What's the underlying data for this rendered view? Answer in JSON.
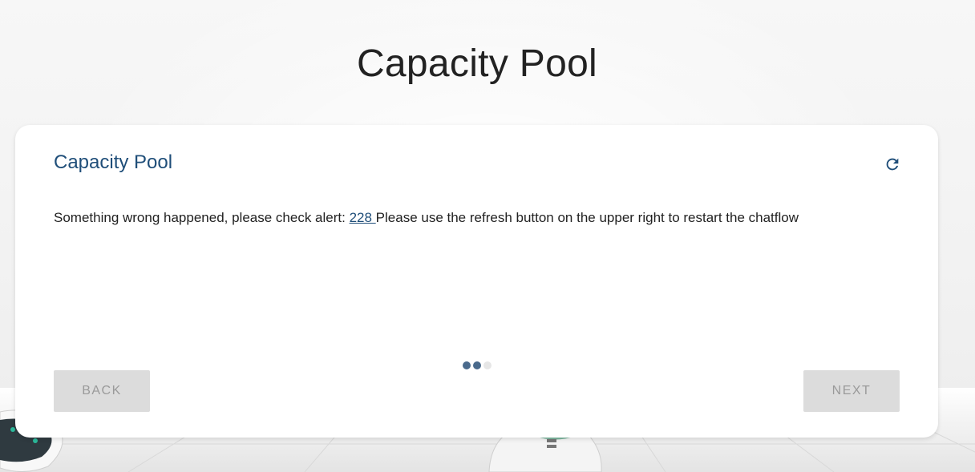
{
  "page": {
    "title": "Capacity Pool"
  },
  "card": {
    "title": "Capacity Pool",
    "refresh_icon": "refresh-icon",
    "message": {
      "prefix": "Something wrong happened, please check alert: ",
      "alert_link": "228 ",
      "suffix": "Please use the refresh button on the upper right to restart the chatflow"
    },
    "stepper": {
      "total_steps": 3,
      "current_step": 2
    },
    "back_label": "Back",
    "next_label": "Next"
  },
  "colors": {
    "accent": "#1f4e79",
    "step_active": "#4a6a8c",
    "button_disabled_bg": "#dcdcdc",
    "button_disabled_text": "#9a9a9a"
  }
}
